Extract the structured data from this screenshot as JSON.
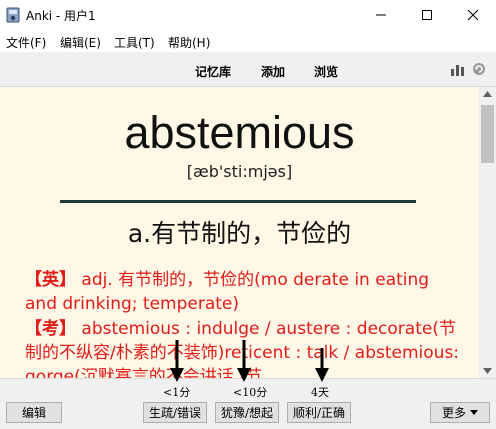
{
  "window": {
    "title": "Anki - 用户1"
  },
  "menu": [
    "文件(F)",
    "编辑(E)",
    "工具(T)",
    "帮助(H)"
  ],
  "toolbar": {
    "decks": "记忆库",
    "add": "添加",
    "browse": "浏览"
  },
  "card": {
    "word": "abstemious",
    "phonetic": "[æb'sti:mjəs]",
    "meaning": "a.有节制的，节俭的",
    "en_tag": "【英】",
    "en_text": "adj. 有节制的，节俭的(mo derate in eating and drinking; temperate)",
    "kao_tag": "【考】",
    "kao_text": "abstemious : indulge / austere : decorate(节制的不纵容/朴素的不装饰)reticent : talk / abstemious: gorge(沉默寡言的不会讲话 /节"
  },
  "bottom": {
    "edit": "编辑",
    "intervals": [
      "<1分",
      "<10分",
      "4天"
    ],
    "answers": [
      "生疏/错误",
      "犹豫/想起",
      "顺利/正确"
    ],
    "more": "更多"
  }
}
